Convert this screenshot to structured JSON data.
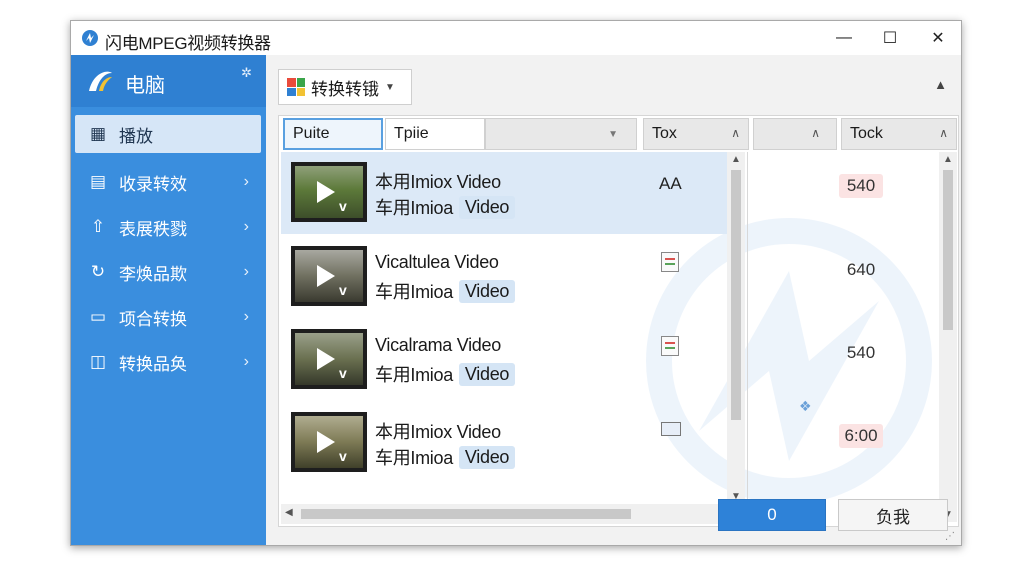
{
  "window": {
    "title": "闪电MPEG视频转换器",
    "controls": {
      "minimize": "—",
      "maximize": "☐",
      "close": "✕"
    }
  },
  "sidebar": {
    "brand": "电脑",
    "items": [
      {
        "label": "播放",
        "icon": "grid-icon",
        "active": true
      },
      {
        "label": "收录转效",
        "icon": "document-icon"
      },
      {
        "label": "表展秩戮",
        "icon": "upload-icon"
      },
      {
        "label": "李焕品欺",
        "icon": "refresh-icon"
      },
      {
        "label": "项合转换",
        "icon": "window-icon"
      },
      {
        "label": "转换品奂",
        "icon": "chat-icon"
      }
    ]
  },
  "toolbar": {
    "dropdown_label": "转换转锇"
  },
  "table": {
    "headers": {
      "col1": "Puite",
      "col2": "Tpiie",
      "col3": "Tox",
      "col4": "",
      "col5": "Tock"
    },
    "rows": [
      {
        "title": "本用Imiox Video",
        "subtitle": "车用Imioa",
        "tag": "Video",
        "type_text": "AA",
        "type_icon": "",
        "res": "540",
        "res_highlight": true
      },
      {
        "title": "Vicaltulea Video",
        "subtitle": "车用Imioa",
        "tag": "Video",
        "type_text": "",
        "type_icon": "file-icon",
        "res": "640",
        "res_highlight": false
      },
      {
        "title": "Vicalrama Video",
        "subtitle": "车用Imioa",
        "tag": "Video",
        "type_text": "",
        "type_icon": "file-icon",
        "res": "540",
        "res_highlight": false
      },
      {
        "title": "本用Imiox Video",
        "subtitle": "车用Imioa",
        "tag": "Video",
        "type_text": "",
        "type_icon": "folder-icon",
        "res": "6:00",
        "res_highlight": true
      }
    ]
  },
  "buttons": {
    "primary": "0",
    "secondary": "负我"
  },
  "colors": {
    "sidebar": "#3a8ede",
    "accent": "#2e82d8",
    "selection": "#dce9f7",
    "highlight": "#fbe3e3"
  }
}
